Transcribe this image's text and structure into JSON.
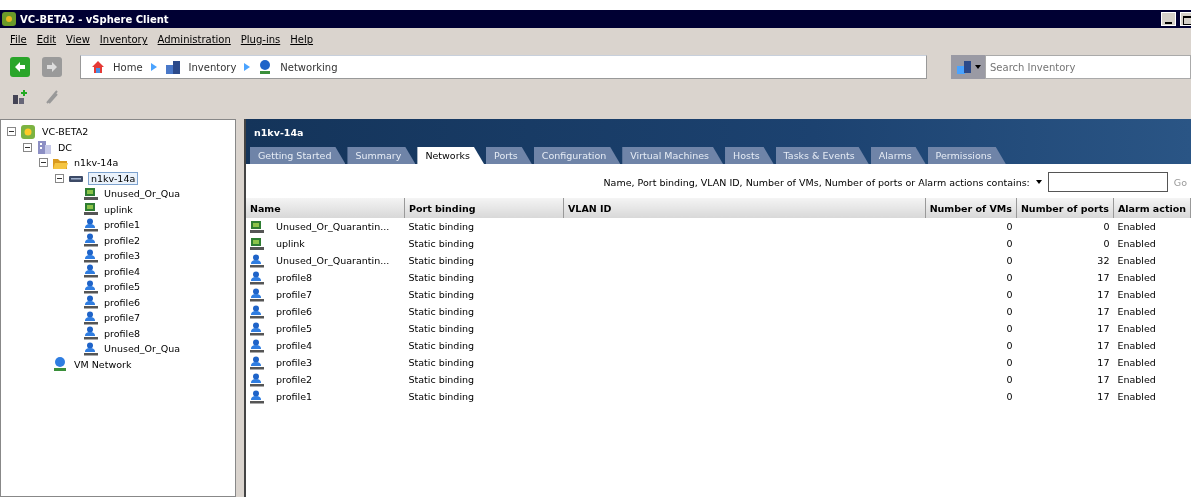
{
  "window": {
    "title": "VC-BETA2 - vSphere Client"
  },
  "menu": [
    "File",
    "Edit",
    "View",
    "Inventory",
    "Administration",
    "Plug-ins",
    "Help"
  ],
  "breadcrumb": [
    "Home",
    "Inventory",
    "Networking"
  ],
  "search": {
    "placeholder": "Search Inventory"
  },
  "tree": [
    {
      "label": "VC-BETA2",
      "kind": "vcenter",
      "expanded": true,
      "selected": false,
      "children": [
        {
          "label": "DC",
          "kind": "datacenter",
          "expanded": true,
          "selected": false,
          "children": [
            {
              "label": "n1kv-14a",
              "kind": "folder",
              "expanded": true,
              "selected": false,
              "children": [
                {
                  "label": "n1kv-14a",
                  "kind": "switch",
                  "expanded": true,
                  "selected": true,
                  "children": [
                    {
                      "label": "Unused_Or_Qua",
                      "kind": "uplink",
                      "selected": false
                    },
                    {
                      "label": "uplink",
                      "kind": "uplink",
                      "selected": false
                    },
                    {
                      "label": "profile1",
                      "kind": "portgroup",
                      "selected": false
                    },
                    {
                      "label": "profile2",
                      "kind": "portgroup",
                      "selected": false
                    },
                    {
                      "label": "profile3",
                      "kind": "portgroup",
                      "selected": false
                    },
                    {
                      "label": "profile4",
                      "kind": "portgroup",
                      "selected": false
                    },
                    {
                      "label": "profile5",
                      "kind": "portgroup",
                      "selected": false
                    },
                    {
                      "label": "profile6",
                      "kind": "portgroup",
                      "selected": false
                    },
                    {
                      "label": "profile7",
                      "kind": "portgroup",
                      "selected": false
                    },
                    {
                      "label": "profile8",
                      "kind": "portgroup",
                      "selected": false
                    },
                    {
                      "label": "Unused_Or_Qua",
                      "kind": "portgroup",
                      "selected": false
                    }
                  ]
                }
              ]
            },
            {
              "label": "VM Network",
              "kind": "network",
              "selected": false
            }
          ]
        }
      ]
    }
  ],
  "panel": {
    "title": "n1kv-14a",
    "tabs": [
      {
        "label": "Getting Started",
        "selected": false
      },
      {
        "label": "Summary",
        "selected": false
      },
      {
        "label": "Networks",
        "selected": true
      },
      {
        "label": "Ports",
        "selected": false
      },
      {
        "label": "Configuration",
        "selected": false
      },
      {
        "label": "Virtual Machines",
        "selected": false
      },
      {
        "label": "Hosts",
        "selected": false
      },
      {
        "label": "Tasks & Events",
        "selected": false
      },
      {
        "label": "Alarms",
        "selected": false
      },
      {
        "label": "Permissions",
        "selected": false
      }
    ],
    "filter": {
      "label": "Name, Port binding, VLAN ID, Number of VMs, Number of ports or Alarm actions contains:",
      "button": "Go"
    },
    "table": {
      "columns": [
        "Name",
        "Port binding",
        "VLAN ID",
        "Number of VMs",
        "Number of ports",
        "Alarm action"
      ],
      "rows": [
        {
          "kind": "uplink",
          "name": "Unused_Or_Quarantin...",
          "binding": "Static binding",
          "vms": "0",
          "ports": "0",
          "alarm": "Enabled"
        },
        {
          "kind": "uplink",
          "name": "uplink",
          "binding": "Static binding",
          "vms": "0",
          "ports": "0",
          "alarm": "Enabled"
        },
        {
          "kind": "portgroup",
          "name": "Unused_Or_Quarantin...",
          "binding": "Static binding",
          "vms": "0",
          "ports": "32",
          "alarm": "Enabled"
        },
        {
          "kind": "portgroup",
          "name": "profile8",
          "binding": "Static binding",
          "vms": "0",
          "ports": "17",
          "alarm": "Enabled"
        },
        {
          "kind": "portgroup",
          "name": "profile7",
          "binding": "Static binding",
          "vms": "0",
          "ports": "17",
          "alarm": "Enabled"
        },
        {
          "kind": "portgroup",
          "name": "profile6",
          "binding": "Static binding",
          "vms": "0",
          "ports": "17",
          "alarm": "Enabled"
        },
        {
          "kind": "portgroup",
          "name": "profile5",
          "binding": "Static binding",
          "vms": "0",
          "ports": "17",
          "alarm": "Enabled"
        },
        {
          "kind": "portgroup",
          "name": "profile4",
          "binding": "Static binding",
          "vms": "0",
          "ports": "17",
          "alarm": "Enabled"
        },
        {
          "kind": "portgroup",
          "name": "profile3",
          "binding": "Static binding",
          "vms": "0",
          "ports": "17",
          "alarm": "Enabled"
        },
        {
          "kind": "portgroup",
          "name": "profile2",
          "binding": "Static binding",
          "vms": "0",
          "ports": "17",
          "alarm": "Enabled"
        },
        {
          "kind": "portgroup",
          "name": "profile1",
          "binding": "Static binding",
          "vms": "0",
          "ports": "17",
          "alarm": "Enabled"
        }
      ]
    }
  }
}
